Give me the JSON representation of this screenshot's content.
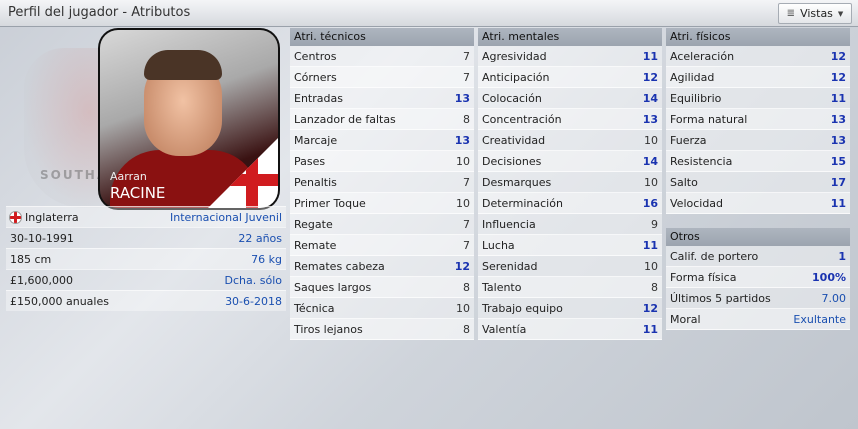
{
  "window": {
    "title": "Perfil del jugador - Atributos",
    "views_label": "Vistas"
  },
  "player": {
    "first_name": "Aarran",
    "last_name": "RACINE",
    "crest_text": "SOUTHA",
    "nationality": "Inglaterra",
    "international_status": "Internacional Juvenil",
    "birth_date": "30-10-1991",
    "age": "22 años",
    "height": "185 cm",
    "weight": "76 kg",
    "value": "£1,600,000",
    "foot": "Dcha. sólo",
    "wage": "£150,000 anuales",
    "contract_end": "30-6-2018"
  },
  "technical": {
    "header": "Atri. técnicos",
    "items": [
      {
        "label": "Centros",
        "value": "7",
        "hi": false
      },
      {
        "label": "Córners",
        "value": "7",
        "hi": false
      },
      {
        "label": "Entradas",
        "value": "13",
        "hi": true
      },
      {
        "label": "Lanzador de faltas",
        "value": "8",
        "hi": false
      },
      {
        "label": "Marcaje",
        "value": "13",
        "hi": true
      },
      {
        "label": "Pases",
        "value": "10",
        "hi": false
      },
      {
        "label": "Penaltis",
        "value": "7",
        "hi": false
      },
      {
        "label": "Primer Toque",
        "value": "10",
        "hi": false
      },
      {
        "label": "Regate",
        "value": "7",
        "hi": false
      },
      {
        "label": "Remate",
        "value": "7",
        "hi": false
      },
      {
        "label": "Remates cabeza",
        "value": "12",
        "hi": true
      },
      {
        "label": "Saques largos",
        "value": "8",
        "hi": false
      },
      {
        "label": "Técnica",
        "value": "10",
        "hi": false
      },
      {
        "label": "Tiros lejanos",
        "value": "8",
        "hi": false
      }
    ]
  },
  "mental": {
    "header": "Atri. mentales",
    "items": [
      {
        "label": "Agresividad",
        "value": "11",
        "hi": true
      },
      {
        "label": "Anticipación",
        "value": "12",
        "hi": true
      },
      {
        "label": "Colocación",
        "value": "14",
        "hi": true
      },
      {
        "label": "Concentración",
        "value": "13",
        "hi": true
      },
      {
        "label": "Creatividad",
        "value": "10",
        "hi": false
      },
      {
        "label": "Decisiones",
        "value": "14",
        "hi": true
      },
      {
        "label": "Desmarques",
        "value": "10",
        "hi": false
      },
      {
        "label": "Determinación",
        "value": "16",
        "hi": true
      },
      {
        "label": "Influencia",
        "value": "9",
        "hi": false
      },
      {
        "label": "Lucha",
        "value": "11",
        "hi": true
      },
      {
        "label": "Serenidad",
        "value": "10",
        "hi": false
      },
      {
        "label": "Talento",
        "value": "8",
        "hi": false
      },
      {
        "label": "Trabajo equipo",
        "value": "12",
        "hi": true
      },
      {
        "label": "Valentía",
        "value": "11",
        "hi": true
      }
    ]
  },
  "physical": {
    "header": "Atri. físicos",
    "items": [
      {
        "label": "Aceleración",
        "value": "12",
        "hi": true
      },
      {
        "label": "Agilidad",
        "value": "12",
        "hi": true
      },
      {
        "label": "Equilibrio",
        "value": "11",
        "hi": true
      },
      {
        "label": "Forma natural",
        "value": "13",
        "hi": true
      },
      {
        "label": "Fuerza",
        "value": "13",
        "hi": true
      },
      {
        "label": "Resistencia",
        "value": "15",
        "hi": true
      },
      {
        "label": "Salto",
        "value": "17",
        "hi": true
      },
      {
        "label": "Velocidad",
        "value": "11",
        "hi": true
      }
    ]
  },
  "others": {
    "header": "Otros",
    "items": [
      {
        "label": "Calif. de portero",
        "value": "1",
        "hi": true
      },
      {
        "label": "Forma física",
        "value": "100%",
        "hi": true
      },
      {
        "label": "Últimos 5 partidos",
        "value": "7.00",
        "hi": false
      },
      {
        "label": "Moral",
        "value": "Exultante",
        "hi": false
      }
    ]
  },
  "colors": {
    "accent_blue": "#1a4fb0",
    "header_bg": "#a5acb6"
  }
}
